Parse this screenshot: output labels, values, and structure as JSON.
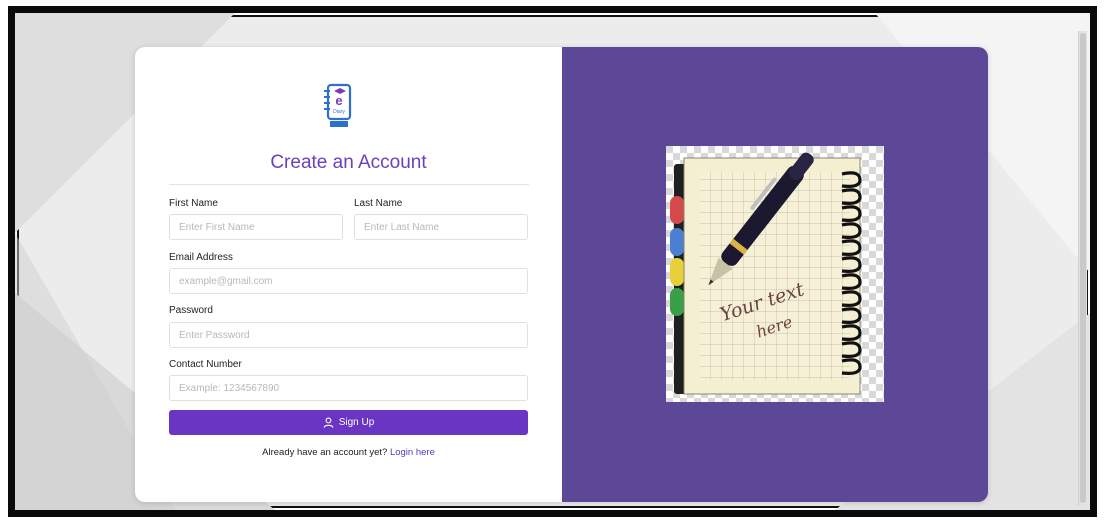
{
  "app": {
    "logo_name": "eDiary",
    "logo_letter": "e",
    "logo_caption": "Diary",
    "title": "Create an Account"
  },
  "form": {
    "first_name_label": "First Name",
    "first_name_placeholder": "Enter First Name",
    "last_name_label": "Last Name",
    "last_name_placeholder": "Enter Last Name",
    "email_label": "Email Address",
    "email_placeholder": "example@gmail.com",
    "password_label": "Password",
    "password_placeholder": "Enter Password",
    "contact_label": "Contact Number",
    "contact_placeholder": "Example: 1234567890",
    "signup_label": "Sign Up",
    "signup_icon": "user-icon",
    "already_text": "Already have an account yet?",
    "login_link": "Login here"
  },
  "illustration": {
    "text_line1": "Your text",
    "text_line2": "here",
    "tab_colors": [
      "#d44a4a",
      "#4a7fd4",
      "#e8d03a",
      "#3aa048"
    ]
  },
  "colors": {
    "accent": "#6a35c2",
    "right_panel": "#5d4898",
    "title": "#6a3fc1"
  }
}
